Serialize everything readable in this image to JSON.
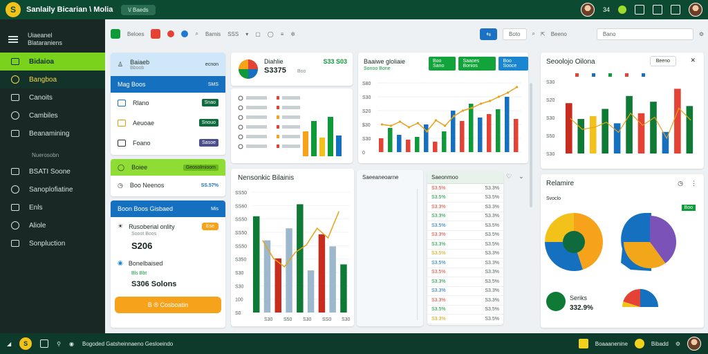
{
  "app": {
    "title": "Sanlaily Bicarian \\ Molia",
    "pill": "\\/ Baeds"
  },
  "sidebar": {
    "header": [
      "Uiaeanel",
      "Blataraniens"
    ],
    "items": [
      {
        "label": "Bidaioa",
        "state": "active"
      },
      {
        "label": "Bangboa",
        "state": "hl"
      },
      {
        "label": "Canoits",
        "state": ""
      },
      {
        "label": "Cambiles",
        "state": ""
      },
      {
        "label": "Beanamining",
        "state": ""
      }
    ],
    "section": "Nuerosobn",
    "items2": [
      {
        "label": "BSATI Soone",
        "state": ""
      },
      {
        "label": "Sanoplofiatine",
        "state": ""
      },
      {
        "label": "Enls",
        "state": ""
      },
      {
        "label": "Aliole",
        "state": ""
      },
      {
        "label": "Sonpluction",
        "state": ""
      }
    ]
  },
  "toolbar": {
    "label1": "Beloes",
    "label2": "Bamis",
    "label3": "SSS",
    "btn": "Boto",
    "search": "Bano"
  },
  "leftcard": {
    "banner1": {
      "title": "Baiaeb",
      "sub": "Bboob",
      "right": "ecnon"
    },
    "banner2": {
      "title": "Mag Boos",
      "right": "SMS"
    },
    "rows": [
      {
        "label": "Rlano",
        "tag": "Snao"
      },
      {
        "label": "Aeuoae",
        "tag": "Snouo"
      },
      {
        "label": "Foano",
        "tag": "Sasoe"
      }
    ],
    "lime": {
      "title": "Boiee",
      "right": "Geosolmioom"
    },
    "lime2": {
      "title": "Boo Neenos",
      "right": "SS.57%"
    },
    "blue3": {
      "title": "Boon Boos Gisbaed",
      "right": "Mis"
    },
    "stat1": {
      "title": "Rusoberial onlity",
      "sub": "Sooot Boos",
      "value": "S206",
      "pill": "Ese"
    },
    "stat2": {
      "title": "Bonelbaised",
      "sub": "Bls Bbt",
      "value": "S306 Solons"
    },
    "orange": "B ® Cosboatin"
  },
  "card2": {
    "title": "Diahlie",
    "value": "S3375",
    "sub": "Boo",
    "right": "S33 S03"
  },
  "card3": {
    "title": "Baaiwe gloliaie",
    "legend": "Sonoo Bone",
    "btns": [
      "Boo Sano",
      "Saaoes Bonios",
      "Boo Sooce"
    ]
  },
  "card4": {
    "title": "Seoolojo Oilona",
    "btn": "Beeno"
  },
  "card5": {
    "title": "Nensonkic Bilainis"
  },
  "card6": {
    "title": "Saeeaneoarne"
  },
  "card7": {
    "title": "Saeonmoo"
  },
  "card8": {
    "title": "Relamire",
    "badge": "Boo",
    "sub": "Svoclo",
    "stat_title": "Seriks",
    "stat_value": "332.9%"
  },
  "chart_data": [
    {
      "type": "line",
      "name": "card3",
      "categories": [
        "1",
        "2",
        "3",
        "4",
        "5",
        "6",
        "7",
        "8",
        "9",
        "10",
        "11",
        "12",
        "13",
        "14",
        "15",
        "16"
      ],
      "values": [
        40,
        38,
        44,
        36,
        42,
        30,
        46,
        38,
        52,
        60,
        64,
        70,
        74,
        80,
        86,
        94
      ],
      "ylim": [
        0,
        100
      ]
    },
    {
      "type": "bar",
      "name": "card3-bars",
      "values": [
        20,
        35,
        25,
        18,
        22,
        40,
        15,
        30,
        60,
        45,
        70,
        50,
        55,
        62,
        80,
        48
      ]
    },
    {
      "type": "bar",
      "name": "card4",
      "values": [
        70,
        48,
        52,
        62,
        42,
        80,
        56,
        72,
        30,
        90,
        66
      ]
    },
    {
      "type": "bar",
      "name": "card5",
      "values": [
        80,
        60,
        45,
        70,
        90,
        35,
        65,
        55,
        40
      ]
    },
    {
      "type": "pie",
      "name": "pie1",
      "values": [
        45,
        30,
        25
      ]
    },
    {
      "type": "pie",
      "name": "pie2",
      "values": [
        40,
        35,
        25
      ]
    }
  ],
  "card3_axis": [
    "S80",
    "S30",
    "S20",
    "$30",
    "S30",
    "0"
  ],
  "card4_axis": [
    "S30",
    "S20",
    "S30",
    "S50",
    "S30"
  ],
  "card5_axis": [
    "SS50",
    "SS60",
    "SS50",
    "SS50",
    "SS50",
    "S350",
    "S30",
    "S30",
    "100",
    "S0"
  ],
  "list_values": [
    "S3.5%",
    "S3.5%",
    "S3.3%",
    "S3.3%",
    "S3.5%",
    "S3.3%",
    "S3.3%",
    "S3.5%",
    "S3.5%",
    "S3.5%",
    "S3.3%",
    "S3.3%",
    "S3.3%",
    "S3.5%",
    "S3.3%",
    "S3.3%"
  ],
  "status": {
    "left": "Bogoded Gatsheinnaeno Gesloeindo",
    "right1": "Boaaanenine",
    "right2": "Bibadd"
  }
}
